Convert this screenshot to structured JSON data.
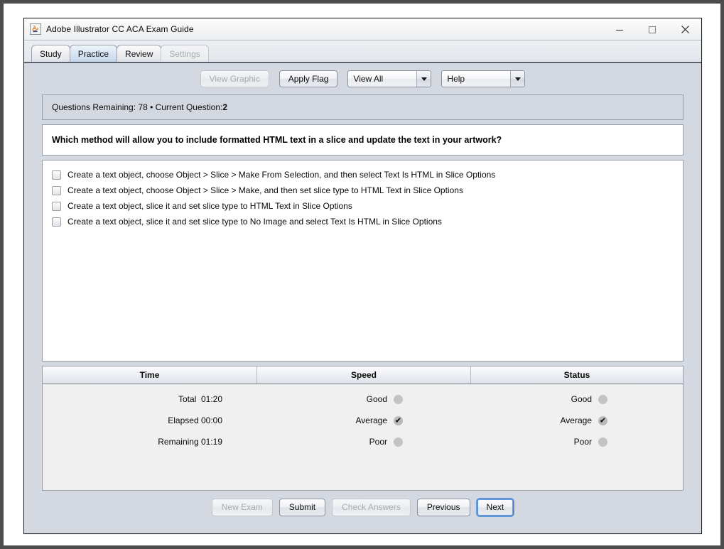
{
  "window": {
    "title": "Adobe Illustrator CC ACA Exam Guide",
    "icon": "java-coffee-cup-icon",
    "controls": {
      "minimize": "—",
      "maximize": "□",
      "close": "✕"
    }
  },
  "tabs": [
    {
      "label": "Study",
      "selected": false,
      "disabled": false
    },
    {
      "label": "Practice",
      "selected": true,
      "disabled": false
    },
    {
      "label": "Review",
      "selected": false,
      "disabled": false
    },
    {
      "label": "Settings",
      "selected": false,
      "disabled": true
    }
  ],
  "toolbar": {
    "view_graphic_label": "View Graphic",
    "view_graphic_disabled": true,
    "apply_flag_label": "Apply Flag",
    "view_filter": {
      "selected": "View All",
      "options": [
        "View All"
      ]
    },
    "help_menu": {
      "selected": "Help",
      "options": [
        "Help"
      ]
    }
  },
  "status": {
    "remaining_label": "Questions Remaining: 78 • Current Question: ",
    "current_question": "2"
  },
  "question": {
    "text": "Which method will allow you to include formatted HTML text in a slice and update the text in your artwork?"
  },
  "answers": [
    {
      "text": "Create a text object, choose Object > Slice > Make From Selection, and then select Text Is HTML in Slice Options",
      "checked": false
    },
    {
      "text": "Create a text object, choose Object > Slice > Make, and then set slice type to HTML Text in Slice Options",
      "checked": false
    },
    {
      "text": "Create a text object, slice it and set slice type to HTML Text in Slice Options",
      "checked": false
    },
    {
      "text": "Create a text object, slice it and set slice type to No Image and select Text Is HTML in Slice Options",
      "checked": false
    }
  ],
  "stats": {
    "headers": {
      "time": "Time",
      "speed": "Speed",
      "status": "Status"
    },
    "rows": [
      {
        "time": "Total  01:20",
        "speed_label": "Good",
        "speed_on": false,
        "status_label": "Good",
        "status_on": false
      },
      {
        "time": "Elapsed 00:00",
        "speed_label": "Average",
        "speed_on": true,
        "status_label": "Average",
        "status_on": true
      },
      {
        "time": "Remaining 01:19",
        "speed_label": "Poor",
        "speed_on": false,
        "status_label": "Poor",
        "status_on": false
      }
    ]
  },
  "footer": {
    "new_exam_label": "New Exam",
    "new_exam_disabled": true,
    "submit_label": "Submit",
    "check_answers_label": "Check Answers",
    "check_answers_disabled": true,
    "previous_label": "Previous",
    "next_label": "Next",
    "next_focused": true
  },
  "colors": {
    "window_bg": "#d4d8e1",
    "panel_white": "#ffffff",
    "status_bar": "#d3d7df",
    "border": "#9aa0ab",
    "tab_selected": "#d6e3f3",
    "focus_ring": "#6a9fe0"
  }
}
